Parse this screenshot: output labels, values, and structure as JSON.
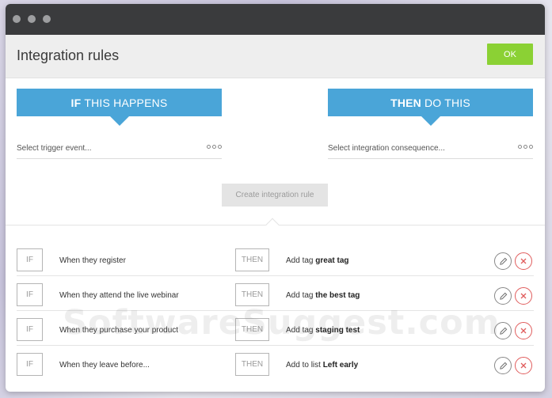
{
  "window": {
    "title": "Integration rules"
  },
  "header": {
    "ok_label": "OK"
  },
  "if_panel": {
    "keyword": "IF",
    "text": "THIS HAPPENS",
    "placeholder": "Select trigger event..."
  },
  "then_panel": {
    "keyword": "THEN",
    "text": "DO THIS",
    "placeholder": "Select integration consequence..."
  },
  "create_button": "Create integration rule",
  "rules": [
    {
      "if": "IF",
      "trigger": "When they register",
      "then": "THEN",
      "action_prefix": "Add tag",
      "action_value": "great tag"
    },
    {
      "if": "IF",
      "trigger": "When they attend the live webinar",
      "then": "THEN",
      "action_prefix": "Add tag",
      "action_value": "the best tag"
    },
    {
      "if": "IF",
      "trigger": "When they purchase your product",
      "then": "THEN",
      "action_prefix": "Add tag",
      "action_value": "staging test"
    },
    {
      "if": "IF",
      "trigger": "When they leave before...",
      "then": "THEN",
      "action_prefix": "Add to list",
      "action_value": "Left early"
    }
  ],
  "watermark": "SoftwareSuggest.com",
  "colors": {
    "accent_blue": "#4aa5d8",
    "ok_green": "#8bd134",
    "delete_red": "#e05c5c"
  },
  "icons": {
    "edit": "pencil-icon",
    "delete": "close-icon",
    "more": "more-dots-icon"
  }
}
